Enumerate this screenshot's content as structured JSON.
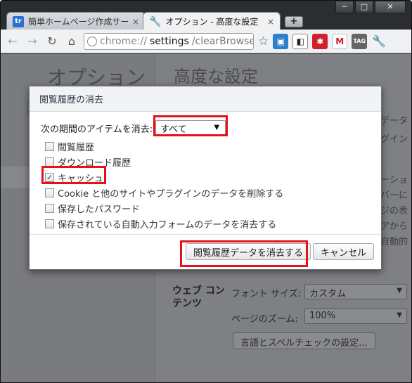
{
  "window": {
    "controls": [
      "─",
      "□",
      "✕"
    ]
  },
  "tabs": [
    {
      "label": "簡単ホームページ作成サービ",
      "close": "×",
      "icon": "site-favicon"
    },
    {
      "label": "オプション - 高度な設定",
      "close": "×",
      "icon": "wrench-icon"
    }
  ],
  "new_tab_label": "+",
  "omnibox": {
    "scheme": "chrome://",
    "host": "settings",
    "path": "/clearBrowser"
  },
  "extensions": [
    {
      "name": "image-extension-icon",
      "color": "#2f7fd0",
      "glyph": "▣"
    },
    {
      "name": "delicious-icon",
      "color": "#222222",
      "glyph": "◧"
    },
    {
      "name": "evernote-extension-icon",
      "color": "#d0202c",
      "glyph": "✱"
    },
    {
      "name": "gmail-icon",
      "color": "#ffffff",
      "glyph": "M"
    },
    {
      "name": "tag-icon",
      "color": "#666666",
      "glyph": "TAG"
    }
  ],
  "background_page": {
    "sidebar_title": "オプション",
    "main_title": "高度な設定",
    "peek_text": [
      "データ",
      "グイン",
      "ーショ",
      "バーに",
      "ジの表",
      "アから",
      "自動的"
    ],
    "web_content_label": "ウェブ コン テンツ",
    "font_size_label": "フォント サイズ:",
    "font_size_value": "カスタム",
    "zoom_label": "ページのズーム:",
    "zoom_value": "100%",
    "spell_button": "言語とスペルチェックの設定..."
  },
  "dialog": {
    "title": "閲覧履歴の消去",
    "period_label": "次の期間のアイテムを消去:",
    "period_value": "すべて",
    "options": [
      {
        "label": "閲覧履歴",
        "checked": false
      },
      {
        "label": "ダウンロード履歴",
        "checked": false
      },
      {
        "label": "キャッシュ",
        "checked": true
      },
      {
        "label": "Cookie と他のサイトやプラグインのデータを削除する",
        "checked": false
      },
      {
        "label": "保存したパスワード",
        "checked": false
      },
      {
        "label": "保存されている自動入力フォームのデータを消去する",
        "checked": false
      }
    ],
    "clear_button": "閲覧履歴データを消去する",
    "cancel_button": "キャンセル"
  },
  "colors": {
    "highlight": "#e8101b",
    "dialog_title": "#2b3440"
  }
}
